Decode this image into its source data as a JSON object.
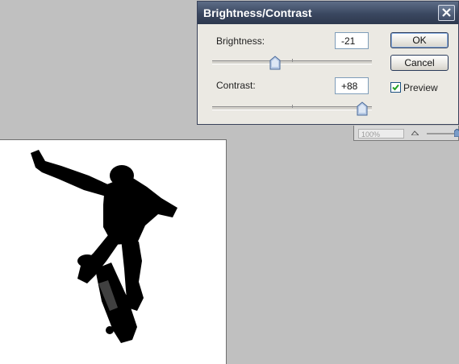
{
  "dialog": {
    "title": "Brightness/Contrast",
    "brightness": {
      "label": "Brightness:",
      "value": "-21",
      "slider_fraction": 0.395
    },
    "contrast": {
      "label": "Contrast:",
      "value": "+88",
      "slider_fraction": 0.94
    },
    "ok_label": "OK",
    "cancel_label": "Cancel",
    "preview_label": "Preview",
    "preview_checked": true
  },
  "status": {
    "zoom": "100%"
  },
  "colors": {
    "titlebar": "#3a4760",
    "dialog_bg": "#ebe9e3",
    "workspace_bg": "#c0c0c0",
    "silhouette": "#000000"
  },
  "icons": [
    "close-icon",
    "checkmark-icon",
    "slider-thumb-icon",
    "mountain-icon"
  ]
}
